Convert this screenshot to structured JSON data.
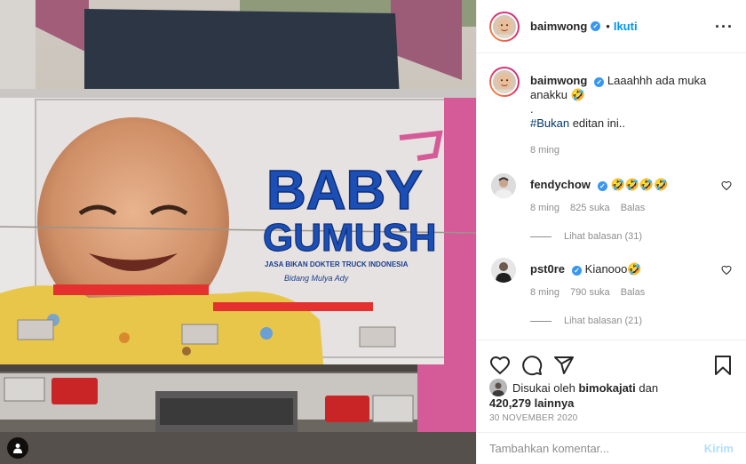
{
  "header": {
    "username": "baimwong",
    "verified_mark": "✓",
    "separator": "•",
    "follow_label": "Ikuti",
    "more_label": "···"
  },
  "caption": {
    "username": "baimwong",
    "line1": "Laaahhh ada muka anakku 🤣",
    "line2": ".",
    "hashtag": "#Bukan",
    "line3_rest": " editan ini..",
    "time": "8 ming"
  },
  "comments": [
    {
      "username": "fendychow",
      "text": "🤣🤣🤣🤣",
      "time": "8 ming",
      "likes": "825 suka",
      "reply_label": "Balas",
      "view_replies": "Lihat balasan (31)"
    },
    {
      "username": "pst0re",
      "text": "Kianooo🤣",
      "time": "8 ming",
      "likes": "790 suka",
      "reply_label": "Balas",
      "view_replies": "Lihat balasan (21)"
    }
  ],
  "likes": {
    "prefix": "Disukai oleh",
    "liker": "bimokajati",
    "mid": "dan",
    "count": "420,279 lainnya"
  },
  "date": "30 NOVEMBER 2020",
  "add_comment": {
    "placeholder": "Tambahkan komentar...",
    "post_label": "Kirim"
  },
  "photo": {
    "sign_line1": "BABY",
    "sign_line2": "GUMUSH",
    "sign_small1": "JASA BIKAN DOKTER TRUCK INDONESIA",
    "sign_small2": "Bidang Mulya Ady"
  },
  "icons": [
    "heart-icon",
    "comment-icon",
    "share-icon",
    "bookmark-icon",
    "user-tag-icon",
    "verified-icon",
    "more-icon"
  ],
  "colors": {
    "accent": "#0095f6",
    "verified": "#3897f0",
    "muted": "#8e8e8e"
  }
}
